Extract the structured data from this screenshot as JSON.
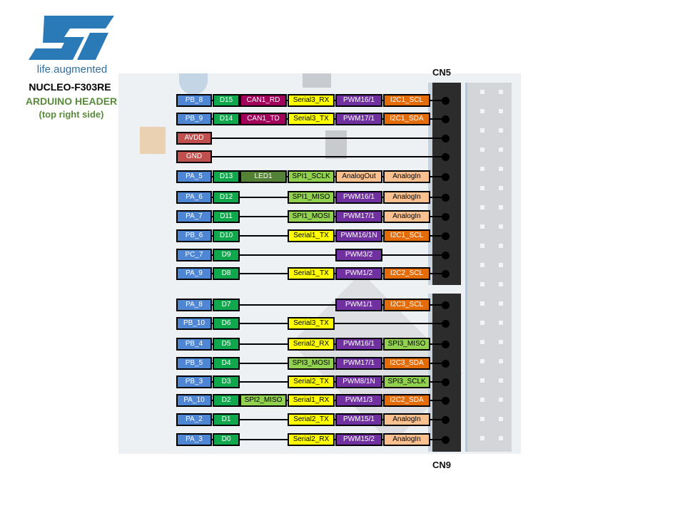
{
  "logo": {
    "icon": "st-logo-icon",
    "tagline_prefix": "life",
    "tagline_dot": ".",
    "tagline_suffix": "augmented",
    "brand_color": "#2f6e9e"
  },
  "titles": {
    "board": "NUCLEO-F303RE",
    "header": "ARDUINO HEADER",
    "side": "(top right side)"
  },
  "connectors": {
    "top": "CN5",
    "bottom": "CN9"
  },
  "colors": {
    "port": "#4f86d4",
    "arduino": "#11a84d",
    "power": "#c0504d",
    "can": "#a0005a",
    "led": "#538135",
    "spi": "#92d050",
    "serial": "#ffff00",
    "pwm": "#7030a0",
    "i2c": "#e36c09",
    "analog": "#fac090"
  },
  "rows": [
    {
      "port": "PB_8",
      "arduino": "D15",
      "c3": {
        "t": "CAN1_RD",
        "k": "can"
      },
      "c4": {
        "t": "Serial3_RX",
        "k": "ser"
      },
      "c5": {
        "t": "PWM16/1",
        "k": "pwm"
      },
      "c6": {
        "t": "I2C1_SCL",
        "k": "i2c"
      }
    },
    {
      "port": "PB_9",
      "arduino": "D14",
      "c3": {
        "t": "CAN1_TD",
        "k": "can"
      },
      "c4": {
        "t": "Serial3_TX",
        "k": "ser"
      },
      "c5": {
        "t": "PWM17/1",
        "k": "pwm"
      },
      "c6": {
        "t": "I2C1_SDA",
        "k": "i2c"
      }
    },
    {
      "port": "AVDD",
      "power": true
    },
    {
      "port": "GND",
      "power": true
    },
    {
      "port": "PA_5",
      "arduino": "D13",
      "c3": {
        "t": "LED1",
        "k": "led"
      },
      "c4": {
        "t": "SPI1_SCLK",
        "k": "spi"
      },
      "c5": {
        "t": "AnalogOut",
        "k": "ana"
      },
      "c6": {
        "t": "AnalogIn",
        "k": "ana"
      }
    },
    {
      "port": "PA_6",
      "arduino": "D12",
      "c4": {
        "t": "SPI1_MISO",
        "k": "spi"
      },
      "c5": {
        "t": "PWM16/1",
        "k": "pwm"
      },
      "c6": {
        "t": "AnalogIn",
        "k": "ana"
      }
    },
    {
      "port": "PA_7",
      "arduino": "D11",
      "c4": {
        "t": "SPI1_MOSI",
        "k": "spi"
      },
      "c5": {
        "t": "PWM17/1",
        "k": "pwm"
      },
      "c6": {
        "t": "AnalogIn",
        "k": "ana"
      }
    },
    {
      "port": "PB_6",
      "arduino": "D10",
      "c4": {
        "t": "Serial1_TX",
        "k": "ser"
      },
      "c5": {
        "t": "PWM16/1N",
        "k": "pwm"
      },
      "c6": {
        "t": "I2C1_SCL",
        "k": "i2c"
      }
    },
    {
      "port": "PC_7",
      "arduino": "D9",
      "c5": {
        "t": "PWM3/2",
        "k": "pwm"
      }
    },
    {
      "port": "PA_9",
      "arduino": "D8",
      "c4": {
        "t": "Serial1_TX",
        "k": "ser"
      },
      "c5": {
        "t": "PWM1/2",
        "k": "pwm"
      },
      "c6": {
        "t": "I2C2_SCL",
        "k": "i2c"
      }
    },
    {
      "port": "PA_8",
      "arduino": "D7",
      "c5": {
        "t": "PWM1/1",
        "k": "pwm"
      },
      "c6": {
        "t": "I2C3_SCL",
        "k": "i2c"
      }
    },
    {
      "port": "PB_10",
      "arduino": "D6",
      "c4": {
        "t": "Serial3_TX",
        "k": "ser"
      }
    },
    {
      "port": "PB_4",
      "arduino": "D5",
      "c4": {
        "t": "Serial2_RX",
        "k": "ser"
      },
      "c5": {
        "t": "PWM16/1",
        "k": "pwm"
      },
      "c6": {
        "t": "SPI3_MISO",
        "k": "spi"
      }
    },
    {
      "port": "PB_5",
      "arduino": "D4",
      "c4": {
        "t": "SPI3_MOSI",
        "k": "spi"
      },
      "c5": {
        "t": "PWM17/1",
        "k": "pwm"
      },
      "c6": {
        "t": "I2C3_SDA",
        "k": "i2c"
      }
    },
    {
      "port": "PB_3",
      "arduino": "D3",
      "c4": {
        "t": "Serial2_TX",
        "k": "ser"
      },
      "c5": {
        "t": "PWM8/1N",
        "k": "pwm"
      },
      "c6": {
        "t": "SPI3_SCLK",
        "k": "spi"
      }
    },
    {
      "port": "PA_10",
      "arduino": "D2",
      "c3": {
        "t": "SPI2_MISO",
        "k": "spi"
      },
      "c4": {
        "t": "Serial1_RX",
        "k": "ser"
      },
      "c5": {
        "t": "PWM1/3",
        "k": "pwm"
      },
      "c6": {
        "t": "I2C2_SDA",
        "k": "i2c"
      }
    },
    {
      "port": "PA_2",
      "arduino": "D1",
      "c4": {
        "t": "Serial2_TX",
        "k": "ser"
      },
      "c5": {
        "t": "PWM15/1",
        "k": "pwm"
      },
      "c6": {
        "t": "AnalogIn",
        "k": "ana"
      }
    },
    {
      "port": "PA_3",
      "arduino": "D0",
      "c4": {
        "t": "Serial2_RX",
        "k": "ser"
      },
      "c5": {
        "t": "PWM15/2",
        "k": "pwm"
      },
      "c6": {
        "t": "AnalogIn",
        "k": "ana"
      }
    }
  ]
}
